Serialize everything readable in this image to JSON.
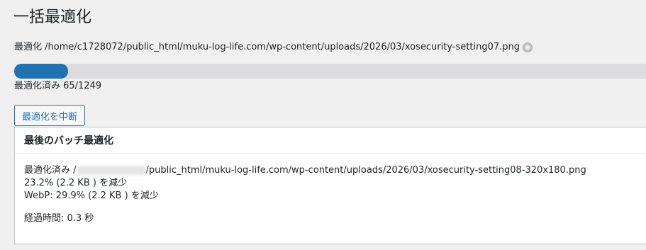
{
  "page": {
    "title": "一括最適化"
  },
  "current": {
    "label": "最適化",
    "path": "/home/c1728072/public_html/muku-log-life.com/wp-content/uploads/2026/03/xosecurity-setting07.png"
  },
  "progress": {
    "done": 65,
    "total": 1249,
    "fraction": 0.052,
    "text": "最適化済み 65/1249",
    "color": "#2271b1"
  },
  "actions": {
    "stop_label": "最適化を中断"
  },
  "last_batch": {
    "heading": "最後のバッチ最適化",
    "optimized_prefix": "最適化済み /",
    "optimized_path": "/public_html/muku-log-life.com/wp-content/uploads/2026/03/xosecurity-setting08-320x180.png",
    "reduction": "23.2% (2.2 KB ) を減少",
    "webp_reduction": "WebP: 29.9% (2.2 KB ) を減少",
    "elapsed": "経過時間: 0.3 秒"
  }
}
